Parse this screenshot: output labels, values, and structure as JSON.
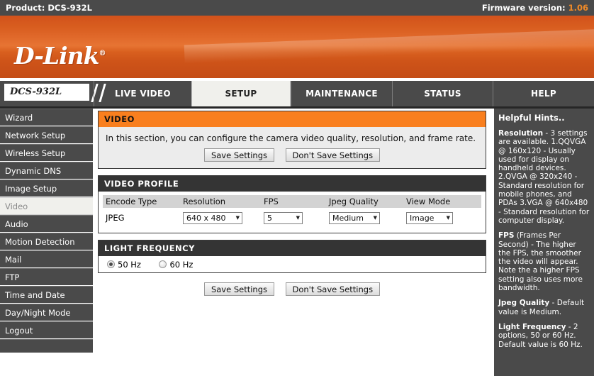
{
  "topbar": {
    "product_label": "Product: DCS-932L",
    "firmware_label": "Firmware version: ",
    "firmware_value": "1.06"
  },
  "brand": {
    "logo_text": "D-Link",
    "registered_mark": "®"
  },
  "nav": {
    "model_tab": "DCS-932L",
    "items": [
      {
        "label": "LIVE VIDEO",
        "active": false
      },
      {
        "label": "SETUP",
        "active": true
      },
      {
        "label": "MAINTENANCE",
        "active": false
      },
      {
        "label": "STATUS",
        "active": false
      },
      {
        "label": "HELP",
        "active": false
      }
    ]
  },
  "sidebar": {
    "items": [
      {
        "label": "Wizard",
        "active": false
      },
      {
        "label": "Network Setup",
        "active": false
      },
      {
        "label": "Wireless Setup",
        "active": false
      },
      {
        "label": "Dynamic DNS",
        "active": false
      },
      {
        "label": "Image Setup",
        "active": false
      },
      {
        "label": "Video",
        "active": true
      },
      {
        "label": "Audio",
        "active": false
      },
      {
        "label": "Motion Detection",
        "active": false
      },
      {
        "label": "Mail",
        "active": false
      },
      {
        "label": "FTP",
        "active": false
      },
      {
        "label": "Time and Date",
        "active": false
      },
      {
        "label": "Day/Night Mode",
        "active": false
      },
      {
        "label": "Logout",
        "active": false
      }
    ]
  },
  "video_section": {
    "title": "VIDEO",
    "description": "In this section, you can configure the camera video quality, resolution, and frame rate.",
    "save_label": "Save Settings",
    "dont_save_label": "Don't Save Settings"
  },
  "video_profile": {
    "title": "VIDEO PROFILE",
    "columns": [
      "Encode Type",
      "Resolution",
      "FPS",
      "Jpeg Quality",
      "View Mode"
    ],
    "row": {
      "encode_type": "JPEG",
      "resolution": "640 x 480",
      "fps": "5",
      "jpeg_quality": "Medium",
      "view_mode": "Image"
    }
  },
  "light_frequency": {
    "title": "LIGHT FREQUENCY",
    "options": [
      {
        "label": "50 Hz",
        "selected": true
      },
      {
        "label": "60 Hz",
        "selected": false
      }
    ]
  },
  "bottom_actions": {
    "save_label": "Save Settings",
    "dont_save_label": "Don't Save Settings"
  },
  "hints": {
    "title": "Helpful Hints..",
    "blocks": [
      {
        "heading": "Resolution",
        "body": " - 3 settings are available. 1.QQVGA @ 160x120 - Usually used for display on handheld devices. 2.QVGA @ 320x240 - Standard resolution for mobile phones, and PDAs 3.VGA @ 640x480 - Standard resolution for computer display."
      },
      {
        "heading": "FPS",
        "body": " (Frames Per Second) - The higher the FPS, the smoother the video will appear. Note the a higher FPS setting also uses more bandwidth."
      },
      {
        "heading": "Jpeg Quality",
        "body": " - Default value is Medium."
      },
      {
        "heading": "Light Frequency",
        "body": " - 2 options, 50 or 60 Hz. Default value is 60 Hz."
      }
    ]
  },
  "icons": {
    "dropdown_arrow": "▼"
  },
  "colors": {
    "accent_orange": "#f97f1e",
    "banner_orange": "#d85d1f",
    "dark_gray": "#4a4a4a",
    "panel_head_dark": "#343434"
  }
}
